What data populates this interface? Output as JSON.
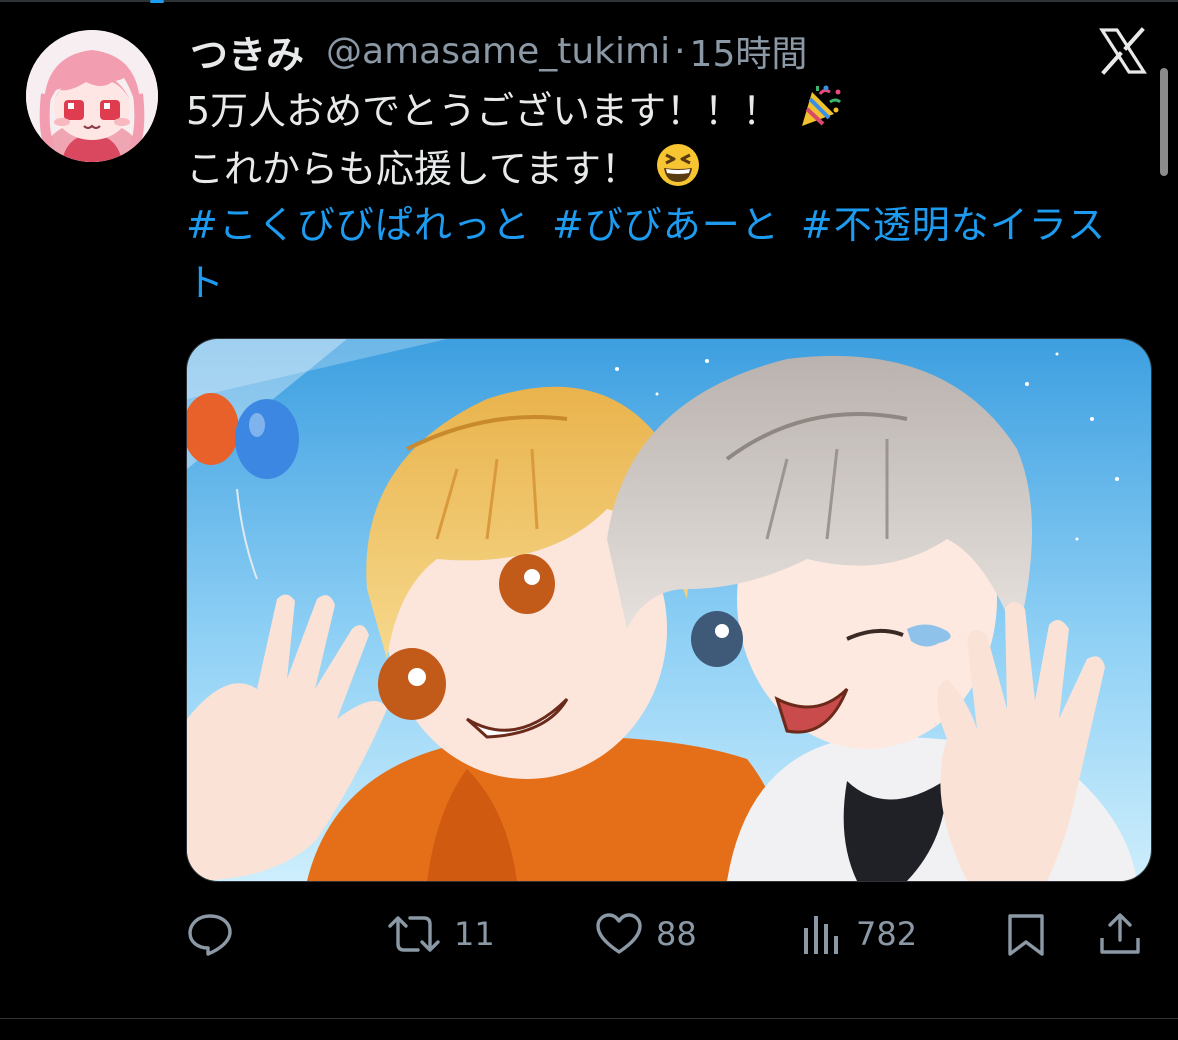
{
  "tweet": {
    "display_name": "つきみ",
    "handle": "@amasame_tukimi",
    "separator": "·",
    "time_ago": "15時間",
    "text_line_1": "5万人おめでとうございます！！！",
    "text_line_2": "これからも応援してます！",
    "hashtags": [
      "#こくびびぱれっと",
      "#びびあーと",
      "#不透明なイラスト"
    ],
    "emoji_1": "party-popper",
    "emoji_2": "grinning-squinting-face"
  },
  "actions": {
    "reply_count": "",
    "retweet_count": "11",
    "like_count": "88",
    "views_count": "782"
  },
  "colors": {
    "background": "#000000",
    "text": "#e7e9ea",
    "muted": "#8b98a5",
    "link": "#1d9bf0",
    "divider": "#2f3336"
  },
  "icons": [
    "x-logo-icon",
    "reply-icon",
    "retweet-icon",
    "like-icon",
    "views-icon",
    "bookmark-icon",
    "share-icon"
  ]
}
